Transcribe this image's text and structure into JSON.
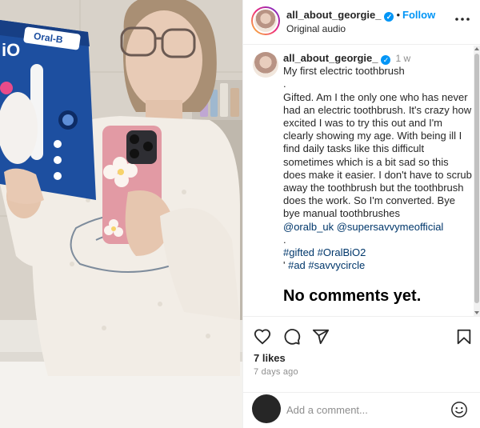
{
  "post": {
    "username": "all_about_georgie_",
    "follow_label": "Follow",
    "separator": "•",
    "verified_mark": "✓",
    "audio_label": "Original audio",
    "more_icon": "more-horizontal-icon"
  },
  "caption": {
    "username": "all_about_georgie_",
    "time_ago": "1 w",
    "lines": [
      "My first electric toothbrush",
      ".",
      "Gifted. Am I the only one who has never had an electric toothbrush. It's crazy how excited I was to try this out and I'm clearly showing my age. With being ill I find daily tasks like this difficult sometimes which is a bit sad so this does make it easier. I don't have to scrub away the toothbrush but the toothbrush does the work. So I'm converted. Bye bye manual toothbrushes"
    ],
    "mentions": [
      "@oralb_uk",
      "@supersavvymeofficial"
    ],
    "dot2": ".",
    "hashtags_line1": [
      "#gifted",
      "#OralBiO2"
    ],
    "hashtags_line2_prefix": "' ",
    "hashtags_line2": [
      "#ad",
      "#savvycircle"
    ],
    "empty_state": "No comments yet."
  },
  "actions": {
    "like_icon": "heart-icon",
    "comment_icon": "comment-icon",
    "share_icon": "send-icon",
    "save_icon": "bookmark-icon",
    "likes_text": "7 likes",
    "posted_ago": "7 days ago"
  },
  "comment": {
    "placeholder": "Add a comment...",
    "emoji_icon": "smiley-icon"
  },
  "product_box": {
    "brand": "Oral-B",
    "model": "iO"
  },
  "colors": {
    "link": "#00376b",
    "follow": "#0095f6",
    "secondary_text": "#8e8e8e",
    "border": "#efefef"
  }
}
